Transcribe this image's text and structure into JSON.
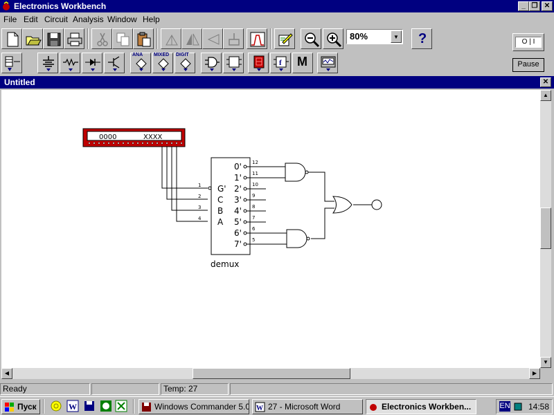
{
  "app": {
    "title": "Electronics Workbench",
    "window_buttons": {
      "minimize": "_",
      "restore": "❐",
      "close": "✕"
    }
  },
  "menu": [
    {
      "label": "File"
    },
    {
      "label": "Edit"
    },
    {
      "label": "Circuit"
    },
    {
      "label": "Analysis"
    },
    {
      "label": "Window"
    },
    {
      "label": "Help"
    }
  ],
  "toolbar": {
    "zoom": "80%",
    "help_label": "?",
    "pause_label": "Pause",
    "power_label": "O | I",
    "parts_labels": {
      "analog": "ANA",
      "mixed": "MIXED",
      "digital": "DIGIT",
      "misc": "M"
    }
  },
  "document": {
    "title": "Untitled",
    "close": "✕"
  },
  "circuit": {
    "word_generator": {
      "left": "0000",
      "right": "XXXX"
    },
    "demux": {
      "name": "demux",
      "inputs": [
        {
          "pin": "1",
          "label": "G'"
        },
        {
          "pin": "2",
          "label": "C"
        },
        {
          "pin": "3",
          "label": "B"
        },
        {
          "pin": "4",
          "label": "A"
        }
      ],
      "outputs": [
        {
          "pin": "12",
          "label": "0'"
        },
        {
          "pin": "11",
          "label": "1'"
        },
        {
          "pin": "10",
          "label": "2'"
        },
        {
          "pin": "9",
          "label": "3'"
        },
        {
          "pin": "8",
          "label": "4'"
        },
        {
          "pin": "7",
          "label": "5'"
        },
        {
          "pin": "6",
          "label": "6'"
        },
        {
          "pin": "5",
          "label": "7'"
        }
      ]
    }
  },
  "status": {
    "state": "Ready",
    "pane2": "",
    "temp": "Temp:  27"
  },
  "taskbar": {
    "start_label": "Пуск",
    "tasks": [
      {
        "label": "Windows Commander 5.0 -..."
      },
      {
        "label": "27 - Microsoft Word"
      },
      {
        "label": "Electronics Workben..."
      }
    ],
    "lang": "EN",
    "clock": "14:58"
  },
  "colors": {
    "titlebar": "#000080",
    "face": "#c0c0c0",
    "word_generator": "#c00000"
  }
}
